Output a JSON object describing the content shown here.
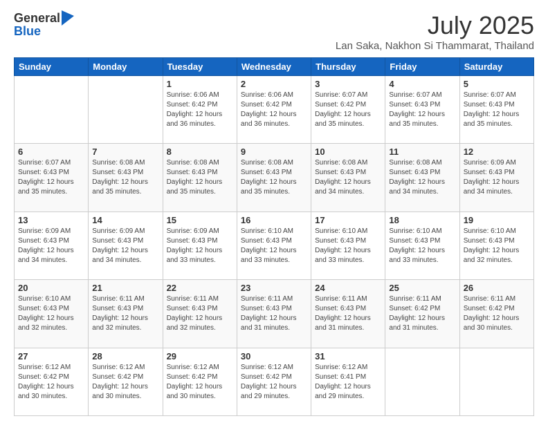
{
  "header": {
    "logo_line1": "General",
    "logo_line2": "Blue",
    "month": "July 2025",
    "location": "Lan Saka, Nakhon Si Thammarat, Thailand"
  },
  "weekdays": [
    "Sunday",
    "Monday",
    "Tuesday",
    "Wednesday",
    "Thursday",
    "Friday",
    "Saturday"
  ],
  "weeks": [
    [
      {
        "day": "",
        "info": ""
      },
      {
        "day": "",
        "info": ""
      },
      {
        "day": "1",
        "info": "Sunrise: 6:06 AM\nSunset: 6:42 PM\nDaylight: 12 hours and 36 minutes."
      },
      {
        "day": "2",
        "info": "Sunrise: 6:06 AM\nSunset: 6:42 PM\nDaylight: 12 hours and 36 minutes."
      },
      {
        "day": "3",
        "info": "Sunrise: 6:07 AM\nSunset: 6:42 PM\nDaylight: 12 hours and 35 minutes."
      },
      {
        "day": "4",
        "info": "Sunrise: 6:07 AM\nSunset: 6:43 PM\nDaylight: 12 hours and 35 minutes."
      },
      {
        "day": "5",
        "info": "Sunrise: 6:07 AM\nSunset: 6:43 PM\nDaylight: 12 hours and 35 minutes."
      }
    ],
    [
      {
        "day": "6",
        "info": "Sunrise: 6:07 AM\nSunset: 6:43 PM\nDaylight: 12 hours and 35 minutes."
      },
      {
        "day": "7",
        "info": "Sunrise: 6:08 AM\nSunset: 6:43 PM\nDaylight: 12 hours and 35 minutes."
      },
      {
        "day": "8",
        "info": "Sunrise: 6:08 AM\nSunset: 6:43 PM\nDaylight: 12 hours and 35 minutes."
      },
      {
        "day": "9",
        "info": "Sunrise: 6:08 AM\nSunset: 6:43 PM\nDaylight: 12 hours and 35 minutes."
      },
      {
        "day": "10",
        "info": "Sunrise: 6:08 AM\nSunset: 6:43 PM\nDaylight: 12 hours and 34 minutes."
      },
      {
        "day": "11",
        "info": "Sunrise: 6:08 AM\nSunset: 6:43 PM\nDaylight: 12 hours and 34 minutes."
      },
      {
        "day": "12",
        "info": "Sunrise: 6:09 AM\nSunset: 6:43 PM\nDaylight: 12 hours and 34 minutes."
      }
    ],
    [
      {
        "day": "13",
        "info": "Sunrise: 6:09 AM\nSunset: 6:43 PM\nDaylight: 12 hours and 34 minutes."
      },
      {
        "day": "14",
        "info": "Sunrise: 6:09 AM\nSunset: 6:43 PM\nDaylight: 12 hours and 34 minutes."
      },
      {
        "day": "15",
        "info": "Sunrise: 6:09 AM\nSunset: 6:43 PM\nDaylight: 12 hours and 33 minutes."
      },
      {
        "day": "16",
        "info": "Sunrise: 6:10 AM\nSunset: 6:43 PM\nDaylight: 12 hours and 33 minutes."
      },
      {
        "day": "17",
        "info": "Sunrise: 6:10 AM\nSunset: 6:43 PM\nDaylight: 12 hours and 33 minutes."
      },
      {
        "day": "18",
        "info": "Sunrise: 6:10 AM\nSunset: 6:43 PM\nDaylight: 12 hours and 33 minutes."
      },
      {
        "day": "19",
        "info": "Sunrise: 6:10 AM\nSunset: 6:43 PM\nDaylight: 12 hours and 32 minutes."
      }
    ],
    [
      {
        "day": "20",
        "info": "Sunrise: 6:10 AM\nSunset: 6:43 PM\nDaylight: 12 hours and 32 minutes."
      },
      {
        "day": "21",
        "info": "Sunrise: 6:11 AM\nSunset: 6:43 PM\nDaylight: 12 hours and 32 minutes."
      },
      {
        "day": "22",
        "info": "Sunrise: 6:11 AM\nSunset: 6:43 PM\nDaylight: 12 hours and 32 minutes."
      },
      {
        "day": "23",
        "info": "Sunrise: 6:11 AM\nSunset: 6:43 PM\nDaylight: 12 hours and 31 minutes."
      },
      {
        "day": "24",
        "info": "Sunrise: 6:11 AM\nSunset: 6:43 PM\nDaylight: 12 hours and 31 minutes."
      },
      {
        "day": "25",
        "info": "Sunrise: 6:11 AM\nSunset: 6:42 PM\nDaylight: 12 hours and 31 minutes."
      },
      {
        "day": "26",
        "info": "Sunrise: 6:11 AM\nSunset: 6:42 PM\nDaylight: 12 hours and 30 minutes."
      }
    ],
    [
      {
        "day": "27",
        "info": "Sunrise: 6:12 AM\nSunset: 6:42 PM\nDaylight: 12 hours and 30 minutes."
      },
      {
        "day": "28",
        "info": "Sunrise: 6:12 AM\nSunset: 6:42 PM\nDaylight: 12 hours and 30 minutes."
      },
      {
        "day": "29",
        "info": "Sunrise: 6:12 AM\nSunset: 6:42 PM\nDaylight: 12 hours and 30 minutes."
      },
      {
        "day": "30",
        "info": "Sunrise: 6:12 AM\nSunset: 6:42 PM\nDaylight: 12 hours and 29 minutes."
      },
      {
        "day": "31",
        "info": "Sunrise: 6:12 AM\nSunset: 6:41 PM\nDaylight: 12 hours and 29 minutes."
      },
      {
        "day": "",
        "info": ""
      },
      {
        "day": "",
        "info": ""
      }
    ]
  ]
}
